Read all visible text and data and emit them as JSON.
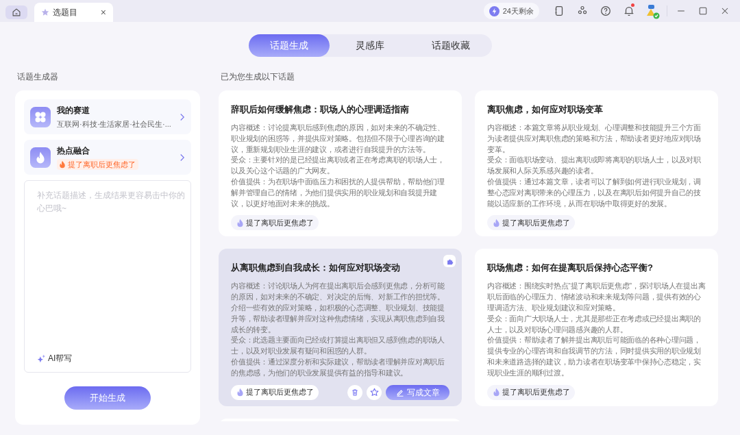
{
  "titlebar": {
    "tab": {
      "title": "选题目",
      "close": "×"
    },
    "trial": "24天剩余",
    "notifications_unread": true
  },
  "mode_tabs": [
    {
      "label": "话题生成",
      "selected": true
    },
    {
      "label": "灵感库",
      "selected": false
    },
    {
      "label": "话题收藏",
      "selected": false
    }
  ],
  "generator": {
    "heading": "话题生成器",
    "options": [
      {
        "kind": "track",
        "title": "我的赛道",
        "subtitle": "互联网·科技·生活家居·社会民生·..."
      },
      {
        "kind": "hotspot",
        "title": "热点融合",
        "tag": "提了离职后更焦虑了"
      }
    ],
    "description": {
      "placeholder": "补充话题描述，生成结果更容易击中你的心巴哦~",
      "ai_label": "AI帮写"
    },
    "start_button": "开始生成"
  },
  "results": {
    "heading": "已为您生成以下话题",
    "columns": [
      [
        {
          "title": "辞职后如何缓解焦虑：职场人的心理调适指南",
          "highlighted": false,
          "paragraphs": [
            "内容概述：讨论提离职后感到焦虑的原因，如对未来的不确定性、职业规划的困惑等，并提供应对策略。包括但不限于心理咨询的建议，重新规划职业生涯的建议，或者进行自我提升的方法等。",
            "受众：主要针对的是已经提出离职或者正在考虑离职的职场人士，以及关心这个话题的广大网友。",
            "价值提供：为在职场中面临压力和困扰的人提供帮助，帮助他们理解并管理自己的情绪，为他们提供实用的职业规划和自我提升建议，以更好地面对未来的挑战。"
          ],
          "tag": "提了离职后更焦虑了"
        },
        {
          "title": "从离职焦虑到自我成长：如何应对职场变动",
          "highlighted": true,
          "paragraphs": [
            "内容概述：讨论职场人为何在提出离职后会感到更焦虑，分析可能的原因，如对未来的不确定、对决定的后悔、对新工作的担忧等。介绍一些有效的应对策略，如积极的心态调整、职业规划、技能提升等，帮助读者理解并应对这种焦虑情绪，实现从离职焦虑到自我成长的转变。",
            "受众：此选题主要面向已经或打算提出离职但又感到焦虑的职场人士，以及对职业发展有疑问和困惑的人群。",
            "价值提供：通过深度分析和实际建议，帮助读者理解并应对离职后的焦虑感，为他们的职业发展提供有益的指导和建议。"
          ],
          "tag": "提了离职后更焦虑了",
          "write_button": "写成文章"
        },
        {
          "kind": "empty"
        }
      ],
      [
        {
          "title": "离职焦虑，如何应对职场变革",
          "highlighted": false,
          "paragraphs": [
            "内容概述：本篇文章将从职业规划、心理调整和技能提升三个方面为读者提供应对离职焦虑的策略和方法，帮助读者更好地应对职场变革。",
            "受众：面临职场变动、提出离职或即将离职的职场人士，以及对职场发展和人际关系感兴趣的读者。",
            "价值提供：通过本篇文章，读者可以了解到如何进行职业规划，调整心态应对离职带来的心理压力，以及在离职后如何提升自己的技能以适应新的工作环境，从而在职场中取得更好的发展。"
          ],
          "tag": "提了离职后更焦虑了"
        },
        {
          "title": "职场焦虑：如何在提离职后保持心态平衡?",
          "highlighted": false,
          "paragraphs": [
            "内容概述：围绕实时热点“提了离职后更焦虑”，探讨职场人在提出离职后面临的心理压力、情绪波动和未来规划等问题，提供有效的心理调适方法、职业规划建议和应对策略。",
            "受众：面向广大职场人士，尤其是那些正在考虑或已经提出离职的人士，以及对职场心理问题感兴趣的人群。",
            "价值提供：帮助读者了解并提出离职后可能面临的各种心理问题，提供专业的心理咨询和自我调节的方法，同时提供实用的职业规划和未来道路选择的建议，助力读者在职场变革中保持心态稳定，实现职业生涯的顺利过渡。"
          ],
          "tag": "提了离职后更焦虑了"
        }
      ]
    ]
  }
}
